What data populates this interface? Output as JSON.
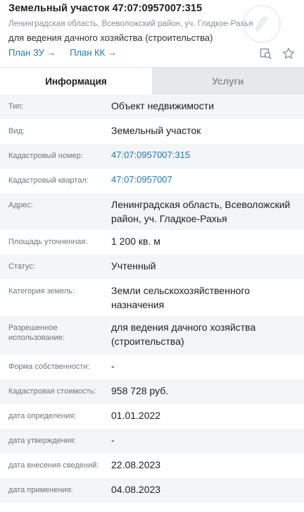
{
  "header": {
    "title": "Земельный участок 47:07:0957007:315",
    "address": "Ленинградская область, Всеволожский район, уч. Гладкое-Рахья",
    "usage": "для ведения дачного хозяйства (строительства)",
    "link_plan_zu": "План ЗУ →",
    "link_plan_kk": "План КК →"
  },
  "tabs": [
    {
      "label": "Информация",
      "active": true
    },
    {
      "label": "Услуги",
      "active": false
    }
  ],
  "rows": [
    {
      "label": "Тип:",
      "value": "Объект недвижимости",
      "link": false
    },
    {
      "label": "Вид:",
      "value": "Земельный участок",
      "link": false
    },
    {
      "label": "Кадастровый номер:",
      "value": "47:07:0957007:315",
      "link": true
    },
    {
      "label": "Кадастровый квартал:",
      "value": "47:07:0957007",
      "link": true
    },
    {
      "label": "Адрес:",
      "value": "Ленинградская область, Всеволожский район, уч. Гладкое-Рахья",
      "link": false
    },
    {
      "label": "Площадь уточненная:",
      "value": "1 200 кв. м",
      "link": false
    },
    {
      "label": "Статус:",
      "value": "Учтенный",
      "link": false
    },
    {
      "label": "Категория земель:",
      "value": "Земли сельскохозяйственного назначения",
      "link": false
    },
    {
      "label": "Разрешенное использование:",
      "value": "для ведения дачного хозяйства (строительства)",
      "link": false
    },
    {
      "label": "Форма собственности:",
      "value": "-",
      "link": false
    },
    {
      "label": "Кадастровая стоимость:",
      "value": "958 728 руб.",
      "link": false
    },
    {
      "label": "дата определения:",
      "value": "01.01.2022",
      "link": false
    },
    {
      "label": "дата утверждения:",
      "value": "-",
      "link": false
    },
    {
      "label": "дата внесения сведений:",
      "value": "22.08.2023",
      "link": false
    },
    {
      "label": "дата применения:",
      "value": "04.08.2023",
      "link": false
    }
  ],
  "icons": {
    "search_map": "search-map-icon",
    "favorite": "star-icon"
  },
  "colors": {
    "link": "#1f78b4",
    "tab_inactive_bg": "#e6e9ec",
    "row_alt_bg": "#f4f5f6"
  }
}
